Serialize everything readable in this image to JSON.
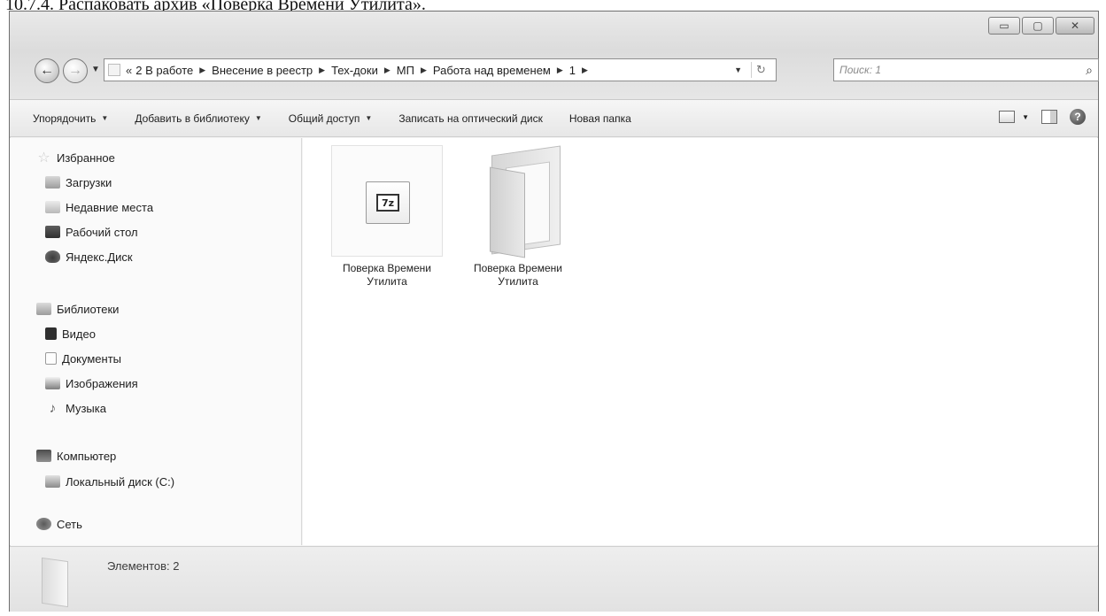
{
  "caption": "10.7.4. Распаковать архив «Поверка Времени Утилита».",
  "window": {
    "controls": {
      "minimize": "▭",
      "maximize": "▢",
      "close": "✕"
    }
  },
  "nav": {
    "back_icon": "←",
    "forward_icon": "→",
    "dropdown_icon": "▼",
    "refresh_icon": "↻",
    "search_icon": "⌕"
  },
  "address": {
    "overflow": "«",
    "separator": "▶",
    "dropdown_icon": "▼",
    "crumbs": [
      "2 В работе",
      "Внесение в реестр",
      "Тех-доки",
      "МП",
      "Работа над временем",
      "1"
    ]
  },
  "search": {
    "placeholder": "Поиск: 1",
    "value": ""
  },
  "toolbar": {
    "arrow": "▼",
    "organize": "Упорядочить",
    "add_to_library": "Добавить в библиотеку",
    "share": "Общий доступ",
    "burn": "Записать на оптический диск",
    "new_folder": "Новая папка",
    "views_arrow": "▼",
    "help": "?"
  },
  "sidebar": {
    "icon_star": "☆",
    "icon_music": "♪",
    "favorites": "Избранное",
    "downloads": "Загрузки",
    "recent": "Недавние места",
    "desktop": "Рабочий стол",
    "yandex_disk": "Яндекс.Диск",
    "libraries": "Библиотеки",
    "video": "Видео",
    "documents": "Документы",
    "images": "Изображения",
    "music": "Музыка",
    "computer": "Компьютер",
    "local_disk": "Локальный диск (C:)",
    "network": "Сеть"
  },
  "files": [
    {
      "name": "Поверка Времени Утилита",
      "type": "archive",
      "badge": "7z"
    },
    {
      "name": "Поверка Времени Утилита",
      "type": "folder"
    }
  ],
  "status": {
    "items_count": "Элементов: 2"
  }
}
